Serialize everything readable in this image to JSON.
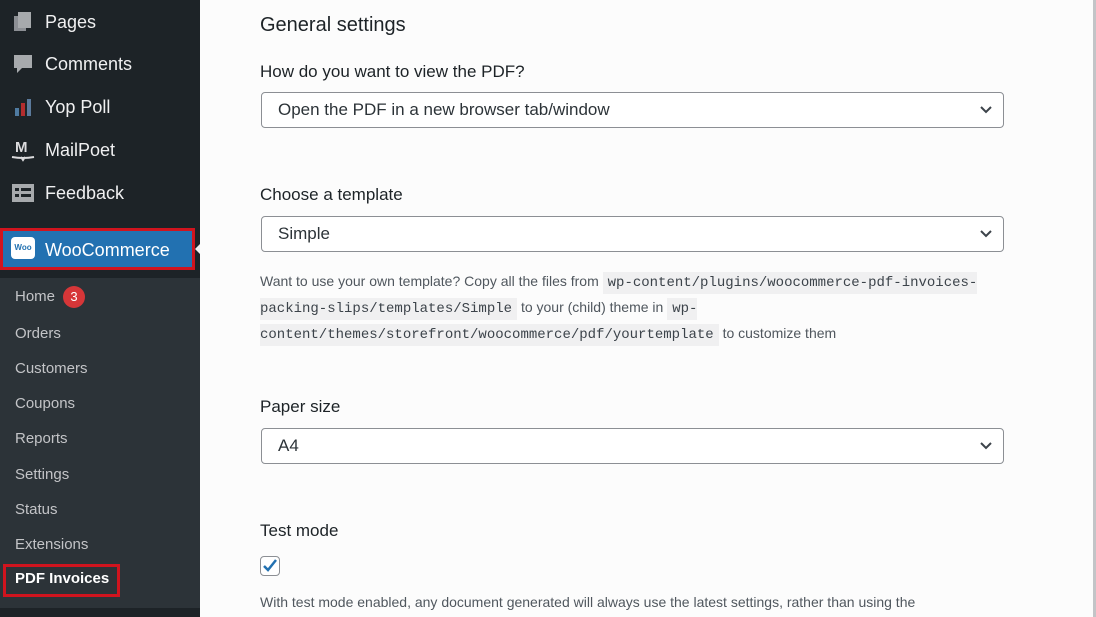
{
  "sidebar": {
    "items": [
      {
        "label": "Pages",
        "icon": "pages-icon"
      },
      {
        "label": "Comments",
        "icon": "comments-icon"
      },
      {
        "label": "Yop Poll",
        "icon": "poll-icon"
      },
      {
        "label": "MailPoet",
        "icon": "mailpoet-icon"
      },
      {
        "label": "Feedback",
        "icon": "feedback-icon"
      }
    ],
    "woocommerce": {
      "label": "WooCommerce",
      "logo_text": "Woo"
    },
    "submenu": [
      {
        "label": "Home",
        "badge": "3"
      },
      {
        "label": "Orders"
      },
      {
        "label": "Customers"
      },
      {
        "label": "Coupons"
      },
      {
        "label": "Reports"
      },
      {
        "label": "Settings"
      },
      {
        "label": "Status"
      },
      {
        "label": "Extensions"
      },
      {
        "label": "PDF Invoices"
      }
    ]
  },
  "main": {
    "section_title": "General settings",
    "view_pdf": {
      "label": "How do you want to view the PDF?",
      "value": "Open the PDF in a new browser tab/window"
    },
    "template": {
      "label": "Choose a template",
      "value": "Simple"
    },
    "help": {
      "t1": "Want to use your own template? Copy all the files from",
      "c1": "wp-content/plugins/woocommerce-pdf-invoices-packing-slips/templates/Simple",
      "t2": "to your (child) theme in",
      "c2": "wp-content/themes/storefront/woocommerce/pdf/yourtemplate",
      "t3": "to customize them"
    },
    "paper_size": {
      "label": "Paper size",
      "value": "A4"
    },
    "test_mode": {
      "label": "Test mode",
      "checked": true,
      "note": "With test mode enabled, any document generated will always use the latest settings, rather than using the"
    }
  },
  "colors": {
    "sidebar_bg": "#1d2327",
    "accent": "#2271b1",
    "highlight_border": "#d0141e",
    "badge": "#d63638"
  }
}
